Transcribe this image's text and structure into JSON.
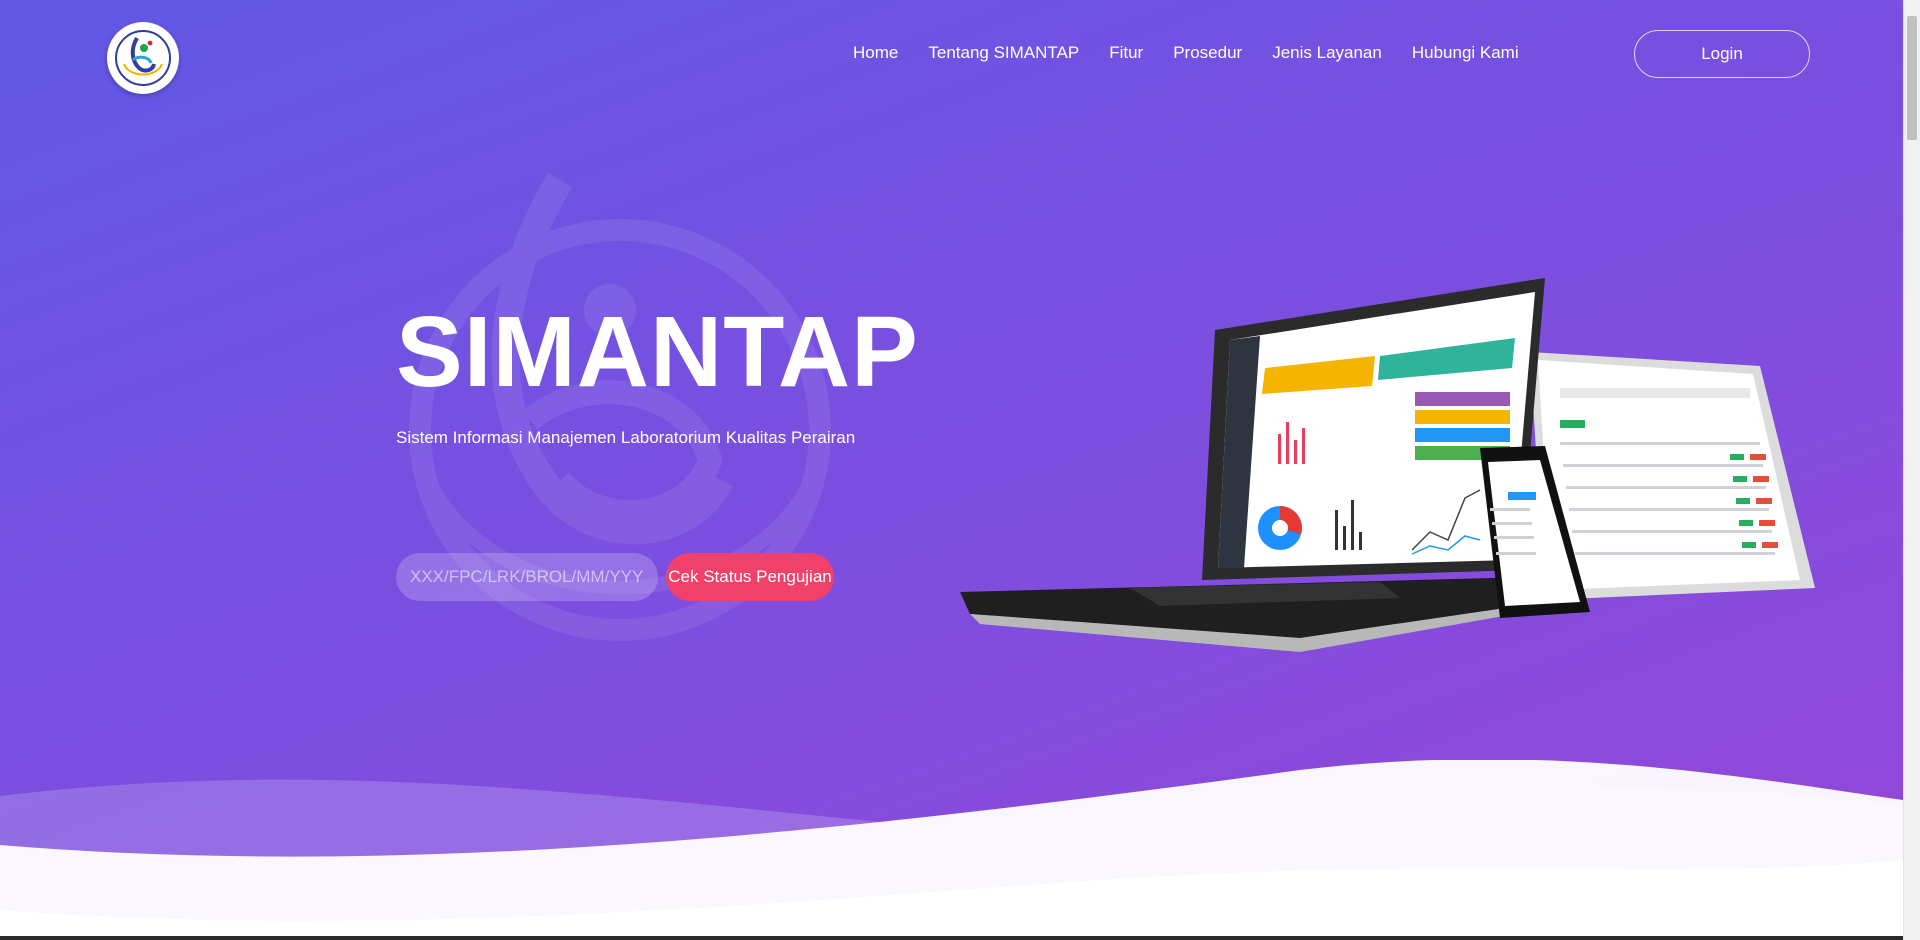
{
  "header": {
    "logo_icon": "kkp-logo-icon",
    "nav": [
      {
        "label": "Home"
      },
      {
        "label": "Tentang SIMANTAP"
      },
      {
        "label": "Fitur"
      },
      {
        "label": "Prosedur"
      },
      {
        "label": "Jenis Layanan"
      },
      {
        "label": "Hubungi Kami"
      }
    ],
    "login_label": "Login"
  },
  "hero": {
    "title": "SIMANTAP",
    "subtitle": "Sistem Informasi Manajemen Laboratorium Kualitas Perairan",
    "search": {
      "placeholder": "XXX/FPC/LRK/BROL/MM/YYYY",
      "value": ""
    },
    "check_label": "Cek Status Pengujian",
    "illustration": "devices-mockup"
  },
  "colors": {
    "gradient_start": "#6258e6",
    "gradient_end": "#9447d8",
    "accent": "#f1406a"
  }
}
